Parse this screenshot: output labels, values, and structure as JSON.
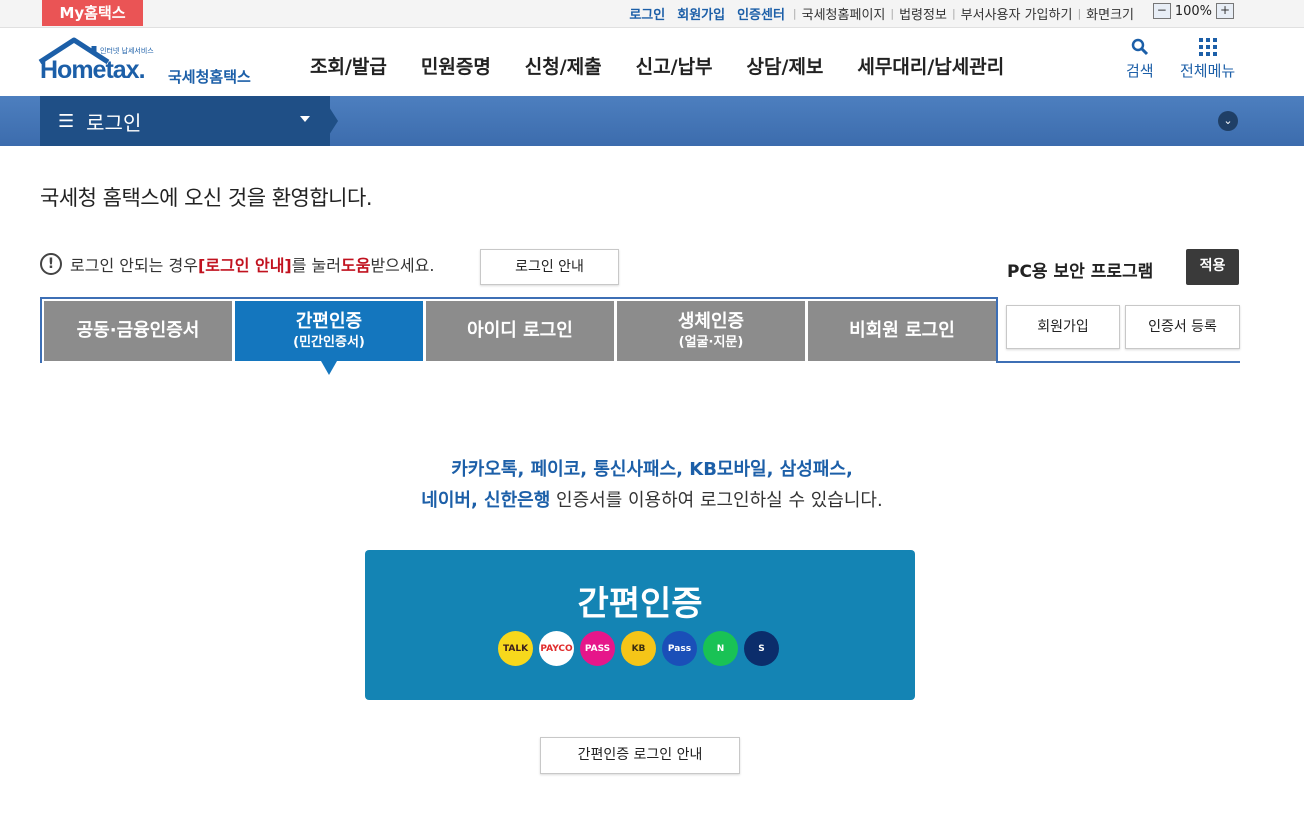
{
  "topbar": {
    "my_hometax": "My홈택스",
    "links_blue": [
      "로그인",
      "회원가입",
      "인증센터"
    ],
    "links_plain": [
      "국세청홈페이지",
      "법령정보",
      "부서사용자 가입하기",
      "화면크기"
    ],
    "zoom_minus": "−",
    "zoom_level": "100%",
    "zoom_plus": "+"
  },
  "header": {
    "logo_small": "인터넷 납세서비스",
    "logo_text": "Hometax.",
    "logo_korean": "국세청홈택스",
    "menu": [
      "조회/발급",
      "민원증명",
      "신청/제출",
      "신고/납부",
      "상담/제보",
      "세무대리/납세관리"
    ],
    "search_label": "검색",
    "all_menu_label": "전체메뉴"
  },
  "location": {
    "title": "로그인"
  },
  "content": {
    "welcome": "국세청 홈택스에 오신 것을 환영합니다.",
    "help_prefix": "로그인 안되는 경우 ",
    "help_bracket": "[로그인 안내]",
    "help_mid": "를 눌러 ",
    "help_bold": "도움",
    "help_suffix": "받으세요.",
    "guide_button": "로그인 안내",
    "pc_security": "PC용 보안 프로그램",
    "apply_button": "적용"
  },
  "tabs": [
    {
      "label": "공동·금융인증서",
      "sub": ""
    },
    {
      "label": "간편인증",
      "sub": "(민간인증서)"
    },
    {
      "label": "아이디 로그인",
      "sub": ""
    },
    {
      "label": "생체인증",
      "sub": "(얼굴·지문)"
    },
    {
      "label": "비회원 로그인",
      "sub": ""
    }
  ],
  "side_buttons": {
    "join": "회원가입",
    "cert_register": "인증서 등록"
  },
  "easy": {
    "desc_line1": "카카오톡, 페이코, 통신사패스, KB모바일, 삼성패스,",
    "desc_line2_hl": "네이버, 신한은행",
    "desc_line2_rest": " 인증서를 이용하여 로그인하실 수 있습니다.",
    "box_title": "간편인증",
    "brands": [
      {
        "name": "TALK",
        "color": "#f7d81c",
        "text_color": "#3a1d1d"
      },
      {
        "name": "PAYCO",
        "color": "#ffffff",
        "text_color": "#e02a2a"
      },
      {
        "name": "PASS",
        "color": "#e6168a",
        "text_color": "#ffffff"
      },
      {
        "name": "KB",
        "color": "#f5c518",
        "text_color": "#3a2d10"
      },
      {
        "name": "Pass",
        "color": "#1a4fb8",
        "text_color": "#ffffff"
      },
      {
        "name": "N",
        "color": "#19c255",
        "text_color": "#ffffff"
      },
      {
        "name": "S",
        "color": "#0b2d6b",
        "text_color": "#ffffff"
      }
    ],
    "guide_button": "간편인증 로그인 안내"
  }
}
